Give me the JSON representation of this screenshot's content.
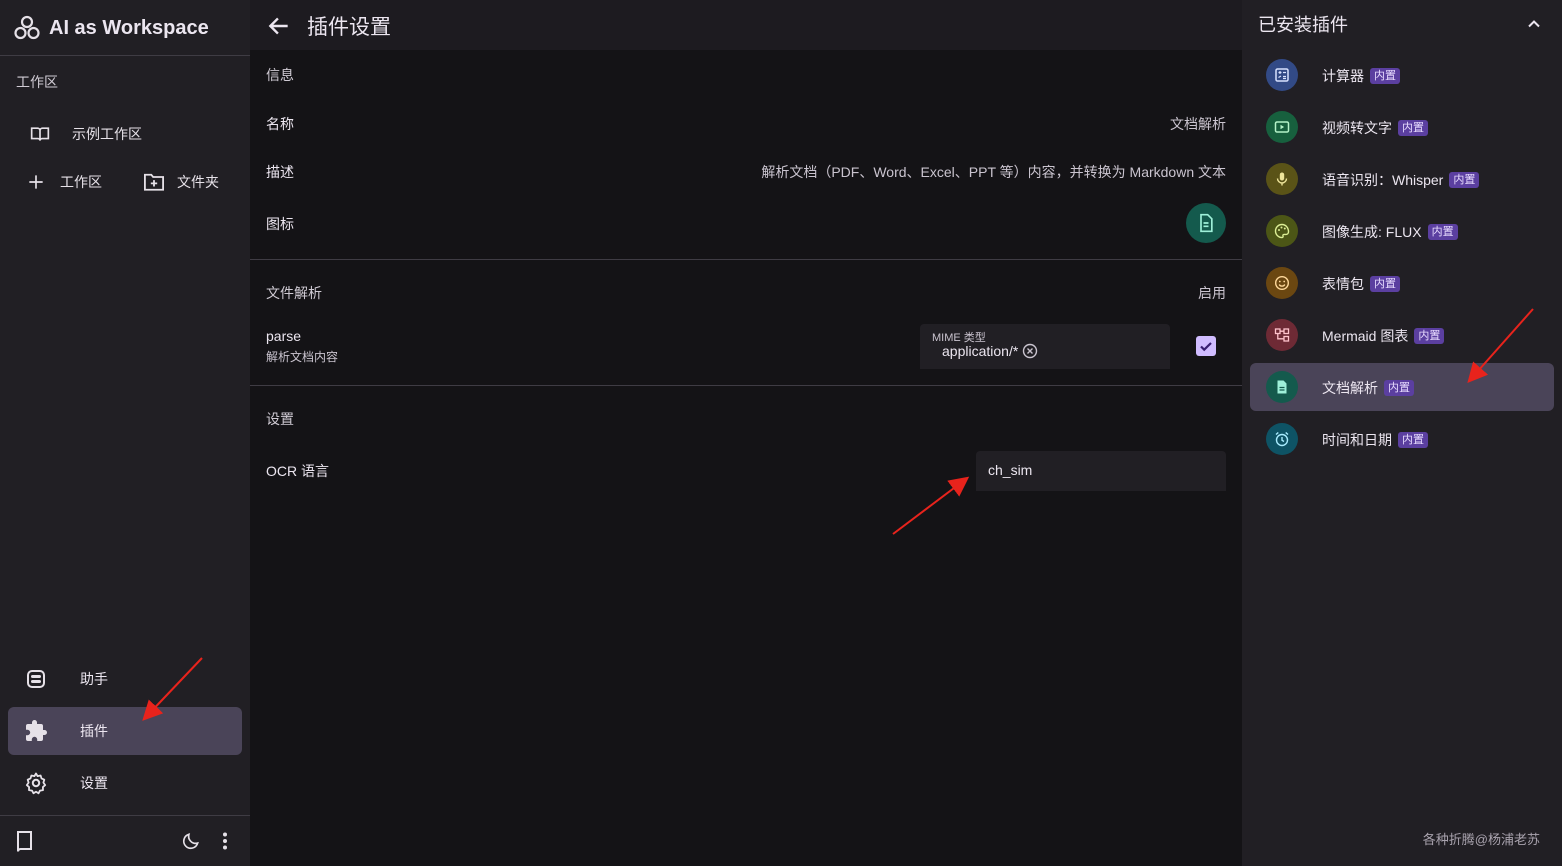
{
  "app": {
    "name": "AI as Workspace"
  },
  "sidebar": {
    "section_label": "工作区",
    "workspace_item": "示例工作区",
    "add_workspace": "工作区",
    "add_folder": "文件夹",
    "nav": [
      {
        "label": "助手",
        "icon": "robot-icon"
      },
      {
        "label": "插件",
        "icon": "puzzle-icon",
        "active": true
      },
      {
        "label": "设置",
        "icon": "gear-icon"
      }
    ]
  },
  "header": {
    "title": "插件设置"
  },
  "main": {
    "info": {
      "section": "信息",
      "name_label": "名称",
      "name_value": "文档解析",
      "desc_label": "描述",
      "desc_value": "解析文档（PDF、Word、Excel、PPT 等）内容，并转换为 Markdown 文本",
      "icon_label": "图标"
    },
    "file_parse": {
      "section": "文件解析",
      "enable_label": "启用",
      "item_name": "parse",
      "item_desc": "解析文档内容",
      "mime_label": "MIME 类型",
      "mime_value": "application/*",
      "enabled": true
    },
    "settings": {
      "section": "设置",
      "ocr_label": "OCR 语言",
      "ocr_value": "ch_sim"
    }
  },
  "right_panel": {
    "title": "已安装插件",
    "badge": "内置",
    "plugins": [
      {
        "name": "计算器",
        "icon": "calculator-icon",
        "color": "#324a86"
      },
      {
        "name": "视频转文字",
        "icon": "video-icon",
        "color": "#17603e"
      },
      {
        "name": "语音识别：Whisper",
        "icon": "mic-icon",
        "color": "#5a5317"
      },
      {
        "name": "图像生成: FLUX",
        "icon": "palette-icon",
        "color": "#4c5616"
      },
      {
        "name": "表情包",
        "icon": "smiley-icon",
        "color": "#6b4711"
      },
      {
        "name": "Mermaid 图表",
        "icon": "diagram-icon",
        "color": "#6e2a35"
      },
      {
        "name": "文档解析",
        "icon": "document-icon",
        "color": "#145a4d",
        "active": true
      },
      {
        "name": "时间和日期",
        "icon": "alarm-icon",
        "color": "#0e5365"
      }
    ],
    "watermark": "各种折腾@杨浦老苏"
  },
  "colors": {
    "accent": "#d0bcff",
    "active_bg": "#4a4458",
    "annotation_arrow": "#e8231c"
  }
}
